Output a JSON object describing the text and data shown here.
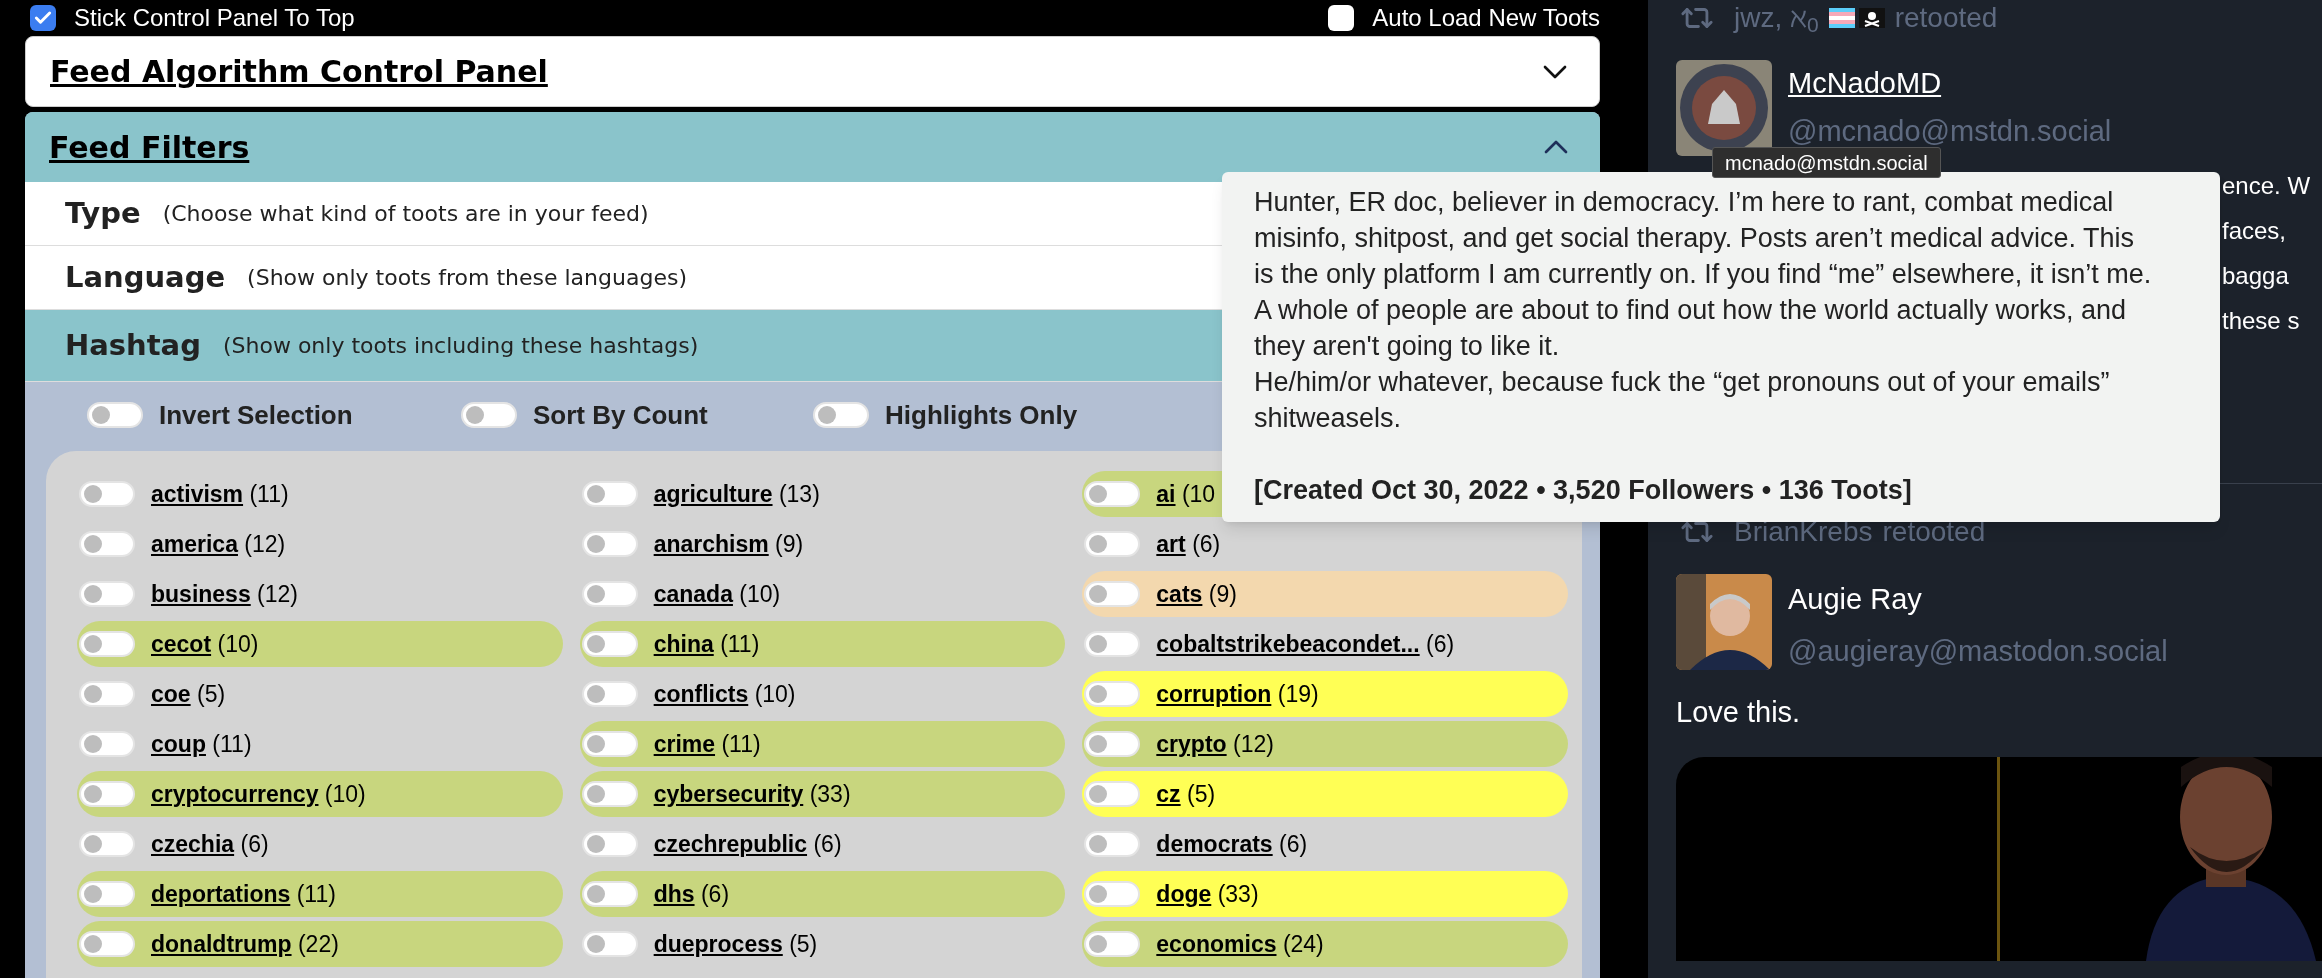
{
  "top_bar": {
    "stick": {
      "label": "Stick Control Panel To Top",
      "checked": true
    },
    "auto_load": {
      "label": "Auto Load New Toots",
      "checked": false
    }
  },
  "control_panel": {
    "title": "Feed Algorithm Control Panel",
    "expanded": false
  },
  "feed_filters": {
    "title": "Feed Filters",
    "expanded": true,
    "sections": [
      {
        "title": "Type",
        "description": "(Choose what kind of toots are in your feed)",
        "expanded": false
      },
      {
        "title": "Language",
        "description": "(Show only toots from these languages)",
        "expanded": false
      },
      {
        "title": "Hashtag",
        "description": "(Show only toots including these hashtags)",
        "expanded": true
      }
    ],
    "options": [
      {
        "label": "Invert Selection",
        "on": false
      },
      {
        "label": "Sort By Count",
        "on": false
      },
      {
        "label": "Highlights Only",
        "on": false
      }
    ],
    "tags": [
      {
        "name": "activism",
        "count": "(11)",
        "on": false
      },
      {
        "name": "agriculture",
        "count": "(13)",
        "on": false
      },
      {
        "name": "ai",
        "count": "(10",
        "on": false,
        "color": "#c8d67e"
      },
      {
        "name": "america",
        "count": "(12)",
        "on": false
      },
      {
        "name": "anarchism",
        "count": "(9)",
        "on": false
      },
      {
        "name": "art",
        "count": "(6)",
        "on": false
      },
      {
        "name": "business",
        "count": "(12)",
        "on": false
      },
      {
        "name": "canada",
        "count": "(10)",
        "on": false
      },
      {
        "name": "cats",
        "count": "(9)",
        "on": false,
        "color": "#f3d8ae"
      },
      {
        "name": "cecot",
        "count": "(10)",
        "on": false,
        "color": "#c8d67e"
      },
      {
        "name": "china",
        "count": "(11)",
        "on": false,
        "color": "#c8d67e"
      },
      {
        "name": "cobaltstrikebeacondet...",
        "count": "(6)",
        "on": false
      },
      {
        "name": "coe",
        "count": "(5)",
        "on": false
      },
      {
        "name": "conflicts",
        "count": "(10)",
        "on": false
      },
      {
        "name": "corruption",
        "count": "(19)",
        "on": false,
        "color": "#ffff55"
      },
      {
        "name": "coup",
        "count": "(11)",
        "on": false
      },
      {
        "name": "crime",
        "count": "(11)",
        "on": false,
        "color": "#c8d67e"
      },
      {
        "name": "crypto",
        "count": "(12)",
        "on": false,
        "color": "#c8d67e"
      },
      {
        "name": "cryptocurrency",
        "count": "(10)",
        "on": false,
        "color": "#c8d67e"
      },
      {
        "name": "cybersecurity",
        "count": "(33)",
        "on": false,
        "color": "#c8d67e"
      },
      {
        "name": "cz",
        "count": "(5)",
        "on": false,
        "color": "#ffff55"
      },
      {
        "name": "czechia",
        "count": "(6)",
        "on": false
      },
      {
        "name": "czechrepublic",
        "count": "(6)",
        "on": false
      },
      {
        "name": "democrats",
        "count": "(6)",
        "on": false
      },
      {
        "name": "deportations",
        "count": "(11)",
        "on": false,
        "color": "#c8d67e"
      },
      {
        "name": "dhs",
        "count": "(6)",
        "on": false,
        "color": "#c8d67e"
      },
      {
        "name": "doge",
        "count": "(33)",
        "on": false,
        "color": "#ffff55"
      },
      {
        "name": "donaldtrump",
        "count": "(22)",
        "on": false,
        "color": "#c8d67e"
      },
      {
        "name": "dueprocess",
        "count": "(5)",
        "on": false
      },
      {
        "name": "economics",
        "count": "(24)",
        "on": false,
        "color": "#c8d67e"
      }
    ]
  },
  "handle_tooltip": {
    "text": "mcnado@mstdn.social"
  },
  "profile_popup": {
    "bio": [
      "Hunter, ER doc, believer in democracy. I’m here to rant, combat medical misinfo, shitpost, and get social therapy. Posts aren’t medical advice. This is the only platform I am currently on. If you find “me” elsewhere, it isn’t me. A whole of people are about to find out how the world actually works, and they aren't going to like it.",
      "He/him/or whatever, because fuck the “get pronouns out of your emails” shitweasels."
    ],
    "stats": "[Created Oct 30, 2022 • 3,520 Followers • 136 Toots]"
  },
  "feed": [
    {
      "retooted_by": "jwz, ℵ$_{0}$",
      "retoot_label": "retooted",
      "flags": true,
      "author": "McNadoMD",
      "author_link": true,
      "handle": "@mcnado@mstdn.social",
      "avatar": {
        "kind": "badge"
      },
      "text_fragments": [
        "ence. W",
        "faces,",
        "bagga",
        "these s"
      ]
    },
    {
      "retooted_by": "BrianKrebs",
      "retoot_label": "retooted",
      "flags": false,
      "author": "Augie Ray",
      "author_link": false,
      "handle": "@augieray@mastodon.social",
      "avatar": {
        "kind": "person"
      },
      "text": "Love this."
    }
  ]
}
